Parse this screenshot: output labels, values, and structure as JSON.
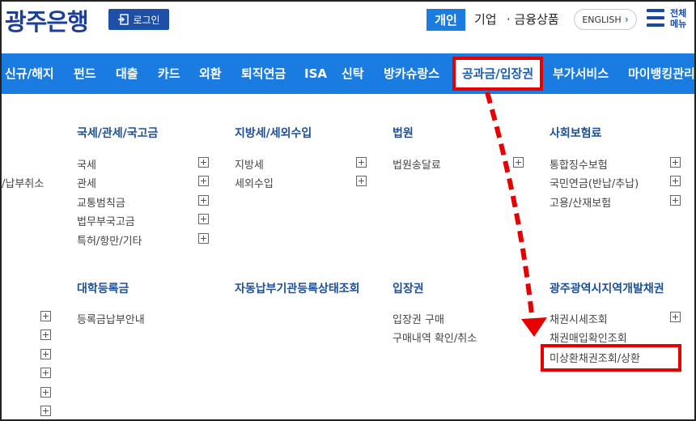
{
  "header": {
    "logo": "광주은행",
    "login_label": "로그인",
    "personal_label": "개인",
    "corp_label": "기업",
    "fin_label": "· 금융상품",
    "english_label": "ENGLISH",
    "menu_line1": "전체",
    "menu_line2": "메뉴"
  },
  "nav": {
    "items": [
      "신규/해지",
      "펀드",
      "대출",
      "카드",
      "외환",
      "퇴직연금",
      "ISA",
      "신탁",
      "방카슈랑스",
      "공과금/입장권",
      "부가서비스",
      "마이뱅킹관리"
    ],
    "active_index": 9
  },
  "left_partial": {
    "item": "/납부취소"
  },
  "sections_row1": [
    {
      "title": "국세/관세/국고금",
      "items": [
        "국세",
        "관세",
        "교통범칙금",
        "법무부국고금",
        "특허/항만/기타"
      ]
    },
    {
      "title": "지방세/세외수입",
      "items": [
        "지방세",
        "세외수입"
      ]
    },
    {
      "title": "법원",
      "items": [
        "법원송달료"
      ]
    },
    {
      "title": "사회보험료",
      "items": [
        "통합징수보험",
        "국민연금(반납/추납)",
        "고용/산재보험"
      ]
    }
  ],
  "sections_row2": [
    {
      "title": "대학등록금",
      "items": [
        "등록금납부안내"
      ]
    },
    {
      "title": "자동납부기관등록상태조회",
      "items": []
    },
    {
      "title": "입장권",
      "items": [
        "입장권 구매",
        "구매내역 확인/취소"
      ]
    },
    {
      "title": "광주광역시지역개발채권",
      "items": [
        "채권시세조회",
        "채권매입확인조회",
        "미상환채권조회/상환"
      ]
    }
  ],
  "annotation": {
    "color": "#e60000"
  },
  "colors": {
    "brand_blue": "#1a7be0",
    "logo_blue": "#1d3f9a",
    "title_blue": "#1d4f9a"
  }
}
